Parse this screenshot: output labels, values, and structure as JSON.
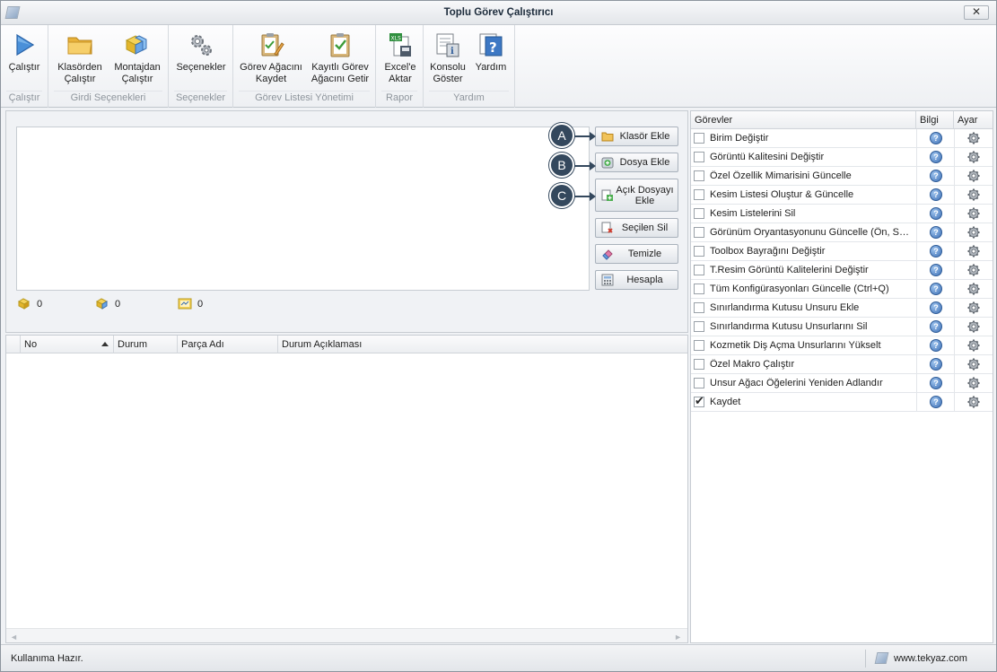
{
  "window": {
    "title": "Toplu Görev Çalıştırıcı",
    "close_label": "✕"
  },
  "ribbon": {
    "groups": [
      {
        "caption": "Çalıştır",
        "buttons": [
          {
            "label": "Çalıştır",
            "icon": "play-icon"
          }
        ]
      },
      {
        "caption": "Girdi Seçenekleri",
        "buttons": [
          {
            "label": "Klasörden\nÇalıştır",
            "icon": "folder-icon"
          },
          {
            "label": "Montajdan\nÇalıştır",
            "icon": "assembly-icon"
          }
        ]
      },
      {
        "caption": "Seçenekler",
        "buttons": [
          {
            "label": "Seçenekler",
            "icon": "gears-icon"
          }
        ]
      },
      {
        "caption": "Görev Listesi Yönetimi",
        "buttons": [
          {
            "label": "Görev Ağacını\nKaydet",
            "icon": "clipboard-edit-icon"
          },
          {
            "label": "Kayıtlı Görev\nAğacını Getir",
            "icon": "clipboard-check-icon"
          }
        ]
      },
      {
        "caption": "Rapor",
        "buttons": [
          {
            "label": "Excel'e\nAktar",
            "icon": "excel-export-icon"
          }
        ]
      },
      {
        "caption": "Yardım",
        "buttons": [
          {
            "label": "Konsolu\nGöster",
            "icon": "console-icon"
          },
          {
            "label": "Yardım",
            "icon": "help-icon"
          }
        ]
      }
    ]
  },
  "input_panel": {
    "buttons": {
      "add_folder": "Klasör Ekle",
      "add_file": "Dosya Ekle",
      "add_open_file": "Açık Dosyayı Ekle",
      "delete_selected": "Seçilen Sil",
      "clear": "Temizle",
      "calculate": "Hesapla"
    },
    "callouts": [
      "A",
      "B",
      "C"
    ],
    "counters": {
      "parts": "0",
      "assemblies": "0",
      "drawings": "0"
    }
  },
  "results_grid": {
    "columns": [
      "No",
      "Durum",
      "Parça Adı",
      "Durum Açıklaması"
    ],
    "rows": []
  },
  "tasks": {
    "columns": {
      "name": "Görevler",
      "info": "Bilgi",
      "settings": "Ayar"
    },
    "items": [
      {
        "name": "Birim Değiştir",
        "checked": false
      },
      {
        "name": "Görüntü Kalitesini Değiştir",
        "checked": false
      },
      {
        "name": "Özel Özellik Mimarisini Güncelle",
        "checked": false
      },
      {
        "name": "Kesim Listesi Oluştur & Güncelle",
        "checked": false
      },
      {
        "name": "Kesim Listelerini Sil",
        "checked": false
      },
      {
        "name": "Görünüm Oryantasyonunu Güncelle (Ön, Sağ...",
        "checked": false
      },
      {
        "name": "Toolbox Bayrağını Değiştir",
        "checked": false
      },
      {
        "name": "T.Resim Görüntü Kalitelerini Değiştir",
        "checked": false
      },
      {
        "name": "Tüm Konfigürasyonları Güncelle (Ctrl+Q)",
        "checked": false
      },
      {
        "name": "Sınırlandırma Kutusu Unsuru Ekle",
        "checked": false
      },
      {
        "name": "Sınırlandırma Kutusu Unsurlarını Sil",
        "checked": false
      },
      {
        "name": "Kozmetik Diş Açma Unsurlarını Yükselt",
        "checked": false
      },
      {
        "name": "Özel Makro Çalıştır",
        "checked": false
      },
      {
        "name": "Unsur Ağacı Öğelerini Yeniden Adlandır",
        "checked": false
      },
      {
        "name": "Kaydet",
        "checked": true
      }
    ]
  },
  "status": {
    "text": "Kullanıma Hazır.",
    "website": "www.tekyaz.com"
  }
}
